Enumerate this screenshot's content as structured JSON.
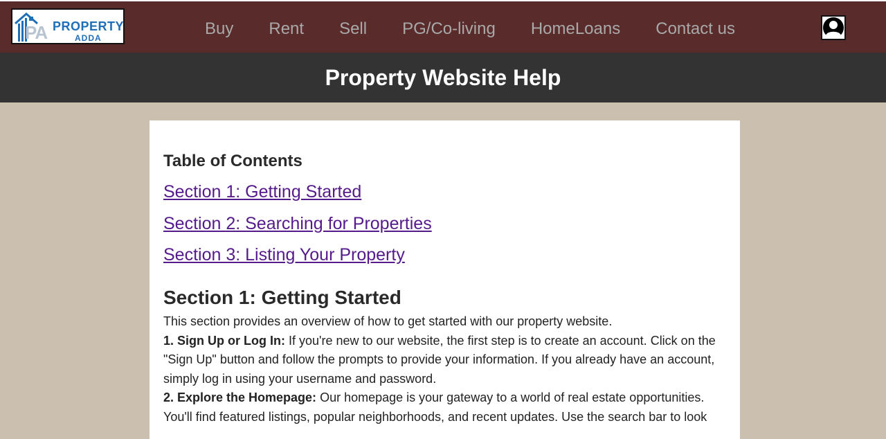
{
  "header": {
    "logo": {
      "title": "PROPERTY",
      "subtitle": "ADDA",
      "initials": "PA"
    },
    "nav": [
      {
        "label": "Buy"
      },
      {
        "label": "Rent"
      },
      {
        "label": "Sell"
      },
      {
        "label": "PG/Co-living"
      },
      {
        "label": "HomeLoans"
      },
      {
        "label": "Contact us"
      }
    ],
    "avatar_icon": "user-icon"
  },
  "banner": {
    "title": "Property Website Help"
  },
  "content": {
    "toc_title": "Table of Contents",
    "toc": [
      {
        "label": "Section 1: Getting Started"
      },
      {
        "label": "Section 2: Searching for Properties"
      },
      {
        "label": "Section 3: Listing Your Property"
      }
    ],
    "section1": {
      "title": "Section 1: Getting Started",
      "intro": "This section provides an overview of how to get started with our property website.",
      "step1_label": "1. Sign Up or Log In:",
      "step1_text": " If you're new to our website, the first step is to create an account. Click on the \"Sign Up\" button and follow the prompts to provide your information. If you already have an account, simply log in using your username and password.",
      "step2_label": "2. Explore the Homepage:",
      "step2_text": " Our homepage is your gateway to a world of real estate opportunities. You'll find featured listings, popular neighborhoods, and recent updates. Use the search bar to look"
    }
  },
  "colors": {
    "navbar": "#5a2b2b",
    "banner": "#333333",
    "page_bg": "#cbbfb0",
    "link": "#551a8b",
    "logo_blue": "#1f6fb8"
  }
}
